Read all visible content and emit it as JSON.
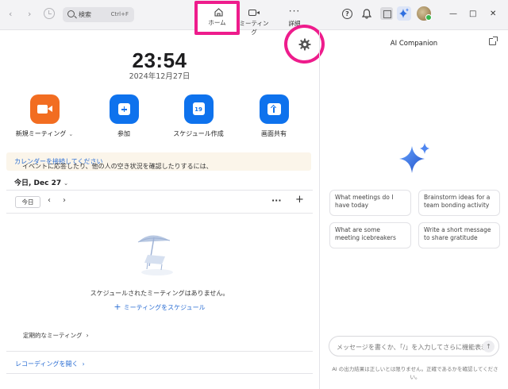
{
  "titlebar": {
    "search_label": "検索",
    "search_shortcut": "Ctrl+F",
    "tabs": [
      {
        "label": "ホーム",
        "icon": "home-icon"
      },
      {
        "label": "ミーティング",
        "icon": "video-icon"
      },
      {
        "label": "詳細",
        "icon": "more-icon"
      }
    ],
    "help_glyph": "?",
    "window_buttons": {
      "minimize": "—",
      "maximize": "□",
      "close": "✕"
    }
  },
  "home": {
    "time": "23:54",
    "date": "2024年12月27日",
    "actions": [
      {
        "label": "新規ミーティング",
        "icon": "video-camera-icon",
        "color": "#f26d21"
      },
      {
        "label": "参加",
        "icon": "plus-icon",
        "color": "#0e72ed"
      },
      {
        "label": "スケジュール作成",
        "icon": "calendar-icon",
        "color": "#0e72ed",
        "badge": "19"
      },
      {
        "label": "画面共有",
        "icon": "share-arrow-icon",
        "color": "#0e72ed"
      }
    ],
    "notice_text": "イベントに応答したり、他の人の空き状況を確認したりするには、",
    "notice_link": "カレンダーを接続してください",
    "today_header": "今日, Dec 27",
    "today_button": "今日",
    "empty_text": "スケジュールされたミーティングはありません。",
    "schedule_link": "ミーティングをスケジュール",
    "recurring_label": "定期的なミーティング",
    "recording_link": "レコーディングを開く"
  },
  "ai": {
    "title": "AI Companion",
    "suggestions": [
      "What meetings do I have today",
      "Brainstorm ideas for a team bonding activity",
      "What are some meeting icebreakers",
      "Write a short message to share gratitude"
    ],
    "input_placeholder": "メッセージを書くか、「/」を入力してさらに機能表示",
    "disclaimer": "AI の出力結果は正しいとは限りません。正確であるかを確認してください。"
  },
  "colors": {
    "accent": "#0e72ed",
    "orange": "#f26d21",
    "highlight": "#ee1c8c",
    "link": "#2a6dd3"
  }
}
